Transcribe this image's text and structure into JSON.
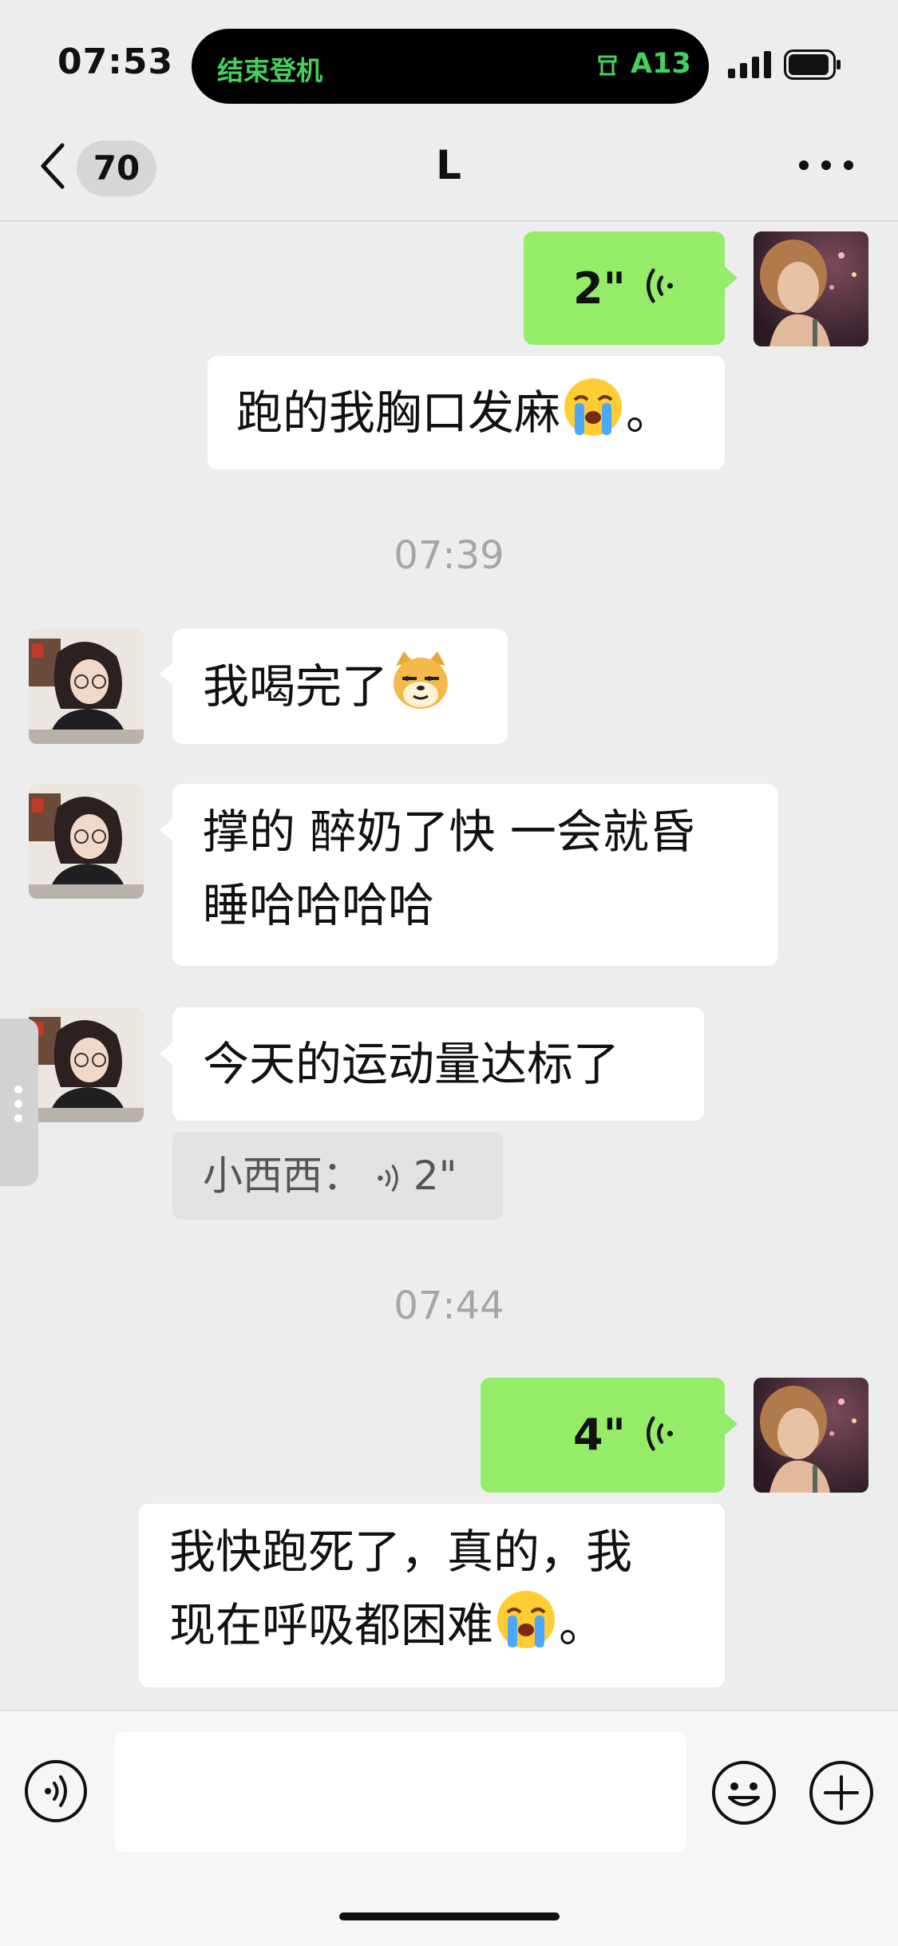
{
  "status_bar": {
    "time": "07:53",
    "island_text": "结束登机",
    "island_flight": "A13"
  },
  "nav": {
    "back_count": "70",
    "title": "L"
  },
  "messages": {
    "m1_voice": {
      "duration": "2\""
    },
    "m2_text": {
      "before": "跑的我胸口发麻",
      "after": "。"
    },
    "ts1": "07:39",
    "m3_text": {
      "text": "我喝完了"
    },
    "m4_text": {
      "line1": "撑的 醉奶了快 一会就昏",
      "line2": "睡哈哈哈哈"
    },
    "m5_text": {
      "text": "今天的运动量达标了"
    },
    "m5_quote": {
      "sender": "小西西：",
      "duration": "2\""
    },
    "ts2": "07:44",
    "m6_voice": {
      "duration": "4\""
    },
    "m7_text": {
      "line1": "我快跑死了，真的，我",
      "line2_before": "现在呼吸都困难",
      "line2_after": "。"
    }
  },
  "input": {
    "value": "",
    "placeholder": ""
  },
  "colors": {
    "sent_bubble": "#95ec69",
    "received_bubble": "#ffffff",
    "background": "#ededed",
    "island_green": "#43d15c"
  },
  "icons": [
    "back-chevron-icon",
    "more-icon",
    "voice-wave-icon",
    "crying-emoji-icon",
    "doge-emoji-icon",
    "voice-input-icon",
    "smiley-icon",
    "plus-icon"
  ]
}
